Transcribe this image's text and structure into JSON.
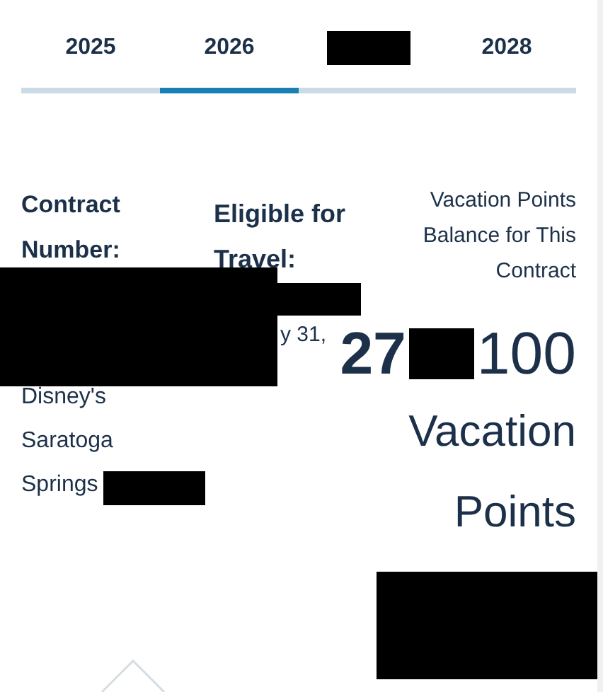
{
  "tabs": [
    {
      "kind": "year",
      "label": "2025",
      "selected": false
    },
    {
      "kind": "year",
      "label": "2026",
      "selected": true
    },
    {
      "kind": "redacted",
      "selected": false
    },
    {
      "kind": "year",
      "label": "2028",
      "selected": false
    }
  ],
  "contract": {
    "label": "Contract Number:",
    "resort": "Disney's Saratoga Springs"
  },
  "eligibility": {
    "label": "Eligible for Travel:",
    "date_fragment": "y 31,"
  },
  "balance": {
    "label": "Vacation Points Balance for This Contract",
    "points_start": "27",
    "points_end": "100",
    "unit": "Vacation Points"
  }
}
